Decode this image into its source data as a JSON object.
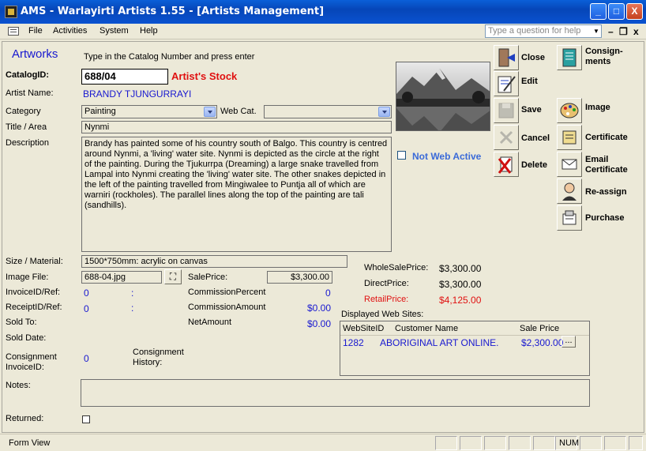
{
  "window": {
    "title": "AMS - Warlayirti Artists 1.55 - [Artists Management]",
    "minimize": "_",
    "maximize": "□",
    "close": "X"
  },
  "menu": {
    "items": [
      "File",
      "Activities",
      "System",
      "Help"
    ],
    "help_placeholder": "Type a question for help",
    "mdi_minimize": "–",
    "mdi_restore": "❐",
    "mdi_close": "x"
  },
  "form": {
    "heading": "Artworks",
    "instruction": "Type in the Catalog Number and press enter",
    "catalog_label": "CatalogID:",
    "catalog_value": "688/04",
    "stock_status": "Artist's Stock",
    "artist_label": "Artist Name:",
    "artist_value": "BRANDY TJUNGURRAYI",
    "category_label": "Category",
    "category_value": "Painting",
    "webcat_label": "Web Cat.",
    "webcat_value": "",
    "title_label": "Title / Area",
    "title_value": "Nynmi",
    "description_label": "Description",
    "description_value": "Brandy has painted some of his country south of Balgo.  This country is centred around Nynmi, a 'living' water site.  Nynmi is depicted as the circle at the right of the painting.  During the Tjukurrpa (Dreaming) a large snake travelled from Lampal into Nynmi creating the 'living' water site.  The other snakes depicted in the left of the painting travelled from Mingiwalee to Puntja all of which are warniri (rockholes).   The parallel lines along the top of the painting are tali (sandhills).",
    "not_web_active": "Not Web Active",
    "size_label": "Size / Material:",
    "size_value": "1500*750mm: acrylic on canvas",
    "image_file_label": "Image File:",
    "image_file_value": "688-04.jpg",
    "saleprice_label": "SalePrice:",
    "saleprice_value": "$3,300.00",
    "invoice_label": "InvoiceID/Ref:",
    "invoice_value": "0",
    "invoice_sep": ":",
    "receipt_label": "ReceiptID/Ref:",
    "receipt_value": "0",
    "receipt_sep": ":",
    "commission_pct_label": "CommissionPercent",
    "commission_pct_value": "0",
    "commission_amt_label": "CommissionAmount",
    "commission_amt_value": "$0.00",
    "soldto_label": "Sold To:",
    "netamount_label": "NetAmount",
    "netamount_value": "$0.00",
    "solddate_label": "Sold Date:",
    "consignment_invoice_label": "Consignment InvoiceID:",
    "consignment_invoice_value": "0",
    "consignment_history_label": "Consignment History:",
    "notes_label": "Notes:",
    "returned_label": "Returned:",
    "wholesale_label": "WholeSalePrice:",
    "wholesale_value": "$3,300.00",
    "direct_label": "DirectPrice:",
    "direct_value": "$3,300.00",
    "retail_label": "RetailPrice:",
    "retail_value": "$4,125.00",
    "websites_label": "Displayed Web Sites:",
    "websites_columns": [
      "WebSiteID",
      "Customer Name",
      "Sale Price"
    ],
    "websites_rows": [
      {
        "id": "1282",
        "customer": "ABORIGINAL ART ONLINE.",
        "price": "$2,300.00",
        "more": "..."
      }
    ]
  },
  "actions": {
    "close": "Close",
    "edit": "Edit",
    "save": "Save",
    "cancel": "Cancel",
    "delete": "Delete",
    "consignments": "Consign- ments",
    "image": "Image",
    "certificate": "Certificate",
    "email_certificate": "Email Certificate",
    "reassign": "Re-assign",
    "purchase": "Purchase"
  },
  "statusbar": {
    "view": "Form View",
    "num": "NUM"
  },
  "colors": {
    "accent_red": "#e01010",
    "label_blue": "#1818d0",
    "web_active_blue": "#3a6ad8"
  }
}
